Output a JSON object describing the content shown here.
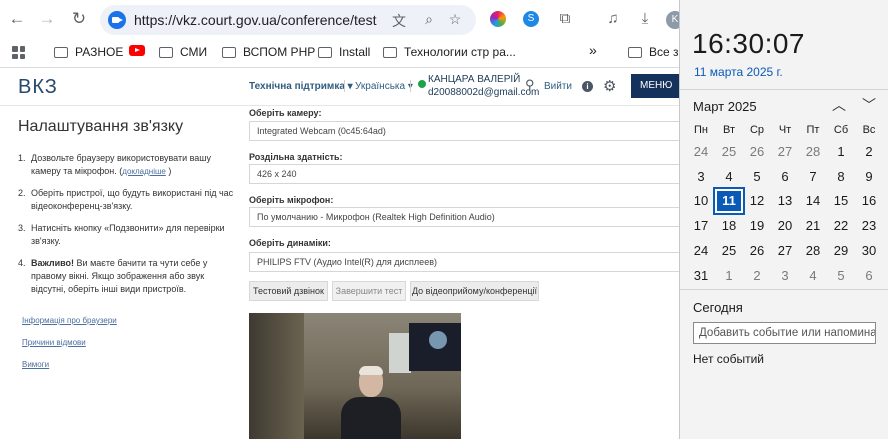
{
  "browser": {
    "url": "https://vkz.court.gov.ua/conference/test",
    "avatar_letter": "K"
  },
  "bookmarks": [
    {
      "label": "РАЗНОЕ",
      "kind": "folder"
    },
    {
      "label": "",
      "kind": "youtube"
    },
    {
      "label": "СМИ",
      "kind": "folder"
    },
    {
      "label": "ВСПОМ PHP",
      "kind": "folder"
    },
    {
      "label": "Install",
      "kind": "folder"
    },
    {
      "label": "Технологии стр ра...",
      "kind": "folder"
    },
    {
      "label": "»",
      "kind": "more"
    },
    {
      "label": "Все за",
      "kind": "folder"
    }
  ],
  "site": {
    "logo": "ВКЗ",
    "support": "Технічна підтримка ▾",
    "language": "Українська ▾",
    "user_name": "КАНЦАРА ВАЛЕРІЙ",
    "user_email": "d20088002d@gmail.com",
    "logout": "Вийти",
    "menu": "МЕНЮ"
  },
  "left": {
    "title": "Налаштування зв'язку",
    "steps": [
      {
        "num": "1.",
        "text": "Дозвольте браузеру використовувати вашу камеру та мікрофон. (",
        "link": "докладніше",
        "after": " )"
      },
      {
        "num": "2.",
        "text": "Оберіть пристрої, що будуть використані під час відеоконференц-зв'язку."
      },
      {
        "num": "3.",
        "text": "Натисніть кнопку «Подзвонити» для перевірки зв'язку."
      },
      {
        "num": "4.",
        "bold": "Важливо!",
        "text": " Ви маєте бачити та чути себе у правому вікні. Якщо зображення або звук відсутні, оберіть інші види пристроїв."
      }
    ],
    "links": [
      "Інформація про браузери",
      "Причини відмови",
      "Вимоги"
    ]
  },
  "form": {
    "camera_label": "Оберіть камеру:",
    "camera_value": "Integrated Webcam (0c45:64ad)",
    "resolution_label": "Роздільна здатність:",
    "resolution_value": "426 x 240",
    "mic_label": "Оберіть мікрофон:",
    "mic_value": "По умолчанию - Микрофон (Realtek High Definition Audio)",
    "speaker_label": "Оберіть динаміки:",
    "speaker_value": "PHILIPS FTV (Аудио Intel(R) для дисплеев)",
    "btn_test": "Тестовий дзвінок",
    "btn_finish": "Завершити тест",
    "btn_conference": "До відеоприйому/конференції"
  },
  "calendar": {
    "time": "16:30:07",
    "date": "11 марта 2025 г.",
    "month": "Март 2025",
    "weekdays": [
      "Пн",
      "Вт",
      "Ср",
      "Чт",
      "Пт",
      "Сб",
      "Вс"
    ],
    "weeks": [
      [
        {
          "d": "24",
          "m": true
        },
        {
          "d": "25",
          "m": true
        },
        {
          "d": "26",
          "m": true
        },
        {
          "d": "27",
          "m": true
        },
        {
          "d": "28",
          "m": true
        },
        {
          "d": "1"
        },
        {
          "d": "2"
        }
      ],
      [
        {
          "d": "3"
        },
        {
          "d": "4"
        },
        {
          "d": "5"
        },
        {
          "d": "6"
        },
        {
          "d": "7"
        },
        {
          "d": "8"
        },
        {
          "d": "9"
        }
      ],
      [
        {
          "d": "10"
        },
        {
          "d": "11",
          "t": true
        },
        {
          "d": "12"
        },
        {
          "d": "13"
        },
        {
          "d": "14"
        },
        {
          "d": "15"
        },
        {
          "d": "16"
        }
      ],
      [
        {
          "d": "17"
        },
        {
          "d": "18"
        },
        {
          "d": "19"
        },
        {
          "d": "20"
        },
        {
          "d": "21"
        },
        {
          "d": "22"
        },
        {
          "d": "23"
        }
      ],
      [
        {
          "d": "24"
        },
        {
          "d": "25"
        },
        {
          "d": "26"
        },
        {
          "d": "27"
        },
        {
          "d": "28"
        },
        {
          "d": "29"
        },
        {
          "d": "30"
        }
      ],
      [
        {
          "d": "31"
        },
        {
          "d": "1",
          "m": true
        },
        {
          "d": "2",
          "m": true
        },
        {
          "d": "3",
          "m": true
        },
        {
          "d": "4",
          "m": true
        },
        {
          "d": "5",
          "m": true
        },
        {
          "d": "6",
          "m": true
        }
      ]
    ],
    "today_label": "Сегодня",
    "event_placeholder": "Добавить событие или напомина",
    "no_events": "Нет событий"
  },
  "colors": {
    "accent": "#0a5ab8",
    "menu": "#14325c",
    "online": "#1ea34a"
  }
}
